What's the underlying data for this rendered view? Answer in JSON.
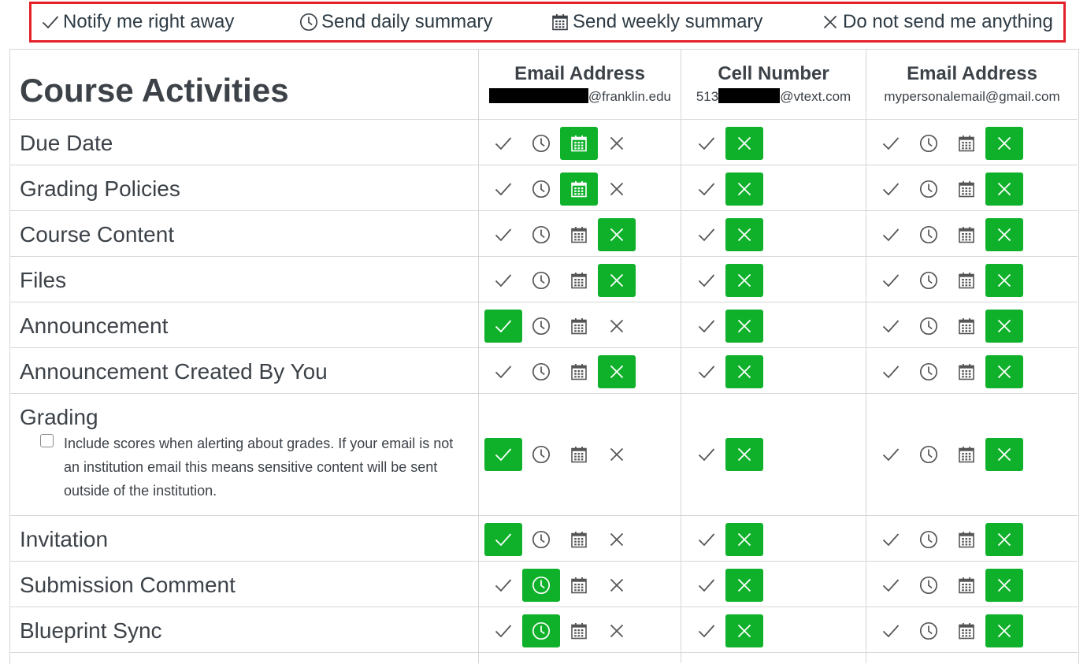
{
  "legend": [
    {
      "icon": "check-icon",
      "label": "Notify me right away"
    },
    {
      "icon": "clock-icon",
      "label": "Send daily summary"
    },
    {
      "icon": "calendar-icon",
      "label": "Send weekly summary"
    },
    {
      "icon": "x-icon",
      "label": "Do not send me anything"
    }
  ],
  "section_title": "Course Activities",
  "channels": [
    {
      "title": "Email Address",
      "address_suffix": "@franklin.edu",
      "options": [
        "check",
        "clock",
        "calendar",
        "x"
      ]
    },
    {
      "title": "Cell Number",
      "address_prefix": "513",
      "address_suffix": "@vtext.com",
      "options": [
        "check",
        "x"
      ]
    },
    {
      "title": "Email Address",
      "address": "mypersonalemail@gmail.com",
      "options": [
        "check",
        "clock",
        "calendar",
        "x"
      ]
    }
  ],
  "grading_note": "Include scores when alerting about grades. If your email is not an institution email this means sensitive content will be sent outside of the institution.",
  "rows": [
    {
      "label": "Due Date",
      "selected": [
        "calendar",
        "x",
        "x"
      ]
    },
    {
      "label": "Grading Policies",
      "selected": [
        "calendar",
        "x",
        "x"
      ]
    },
    {
      "label": "Course Content",
      "selected": [
        "x",
        "x",
        "x"
      ]
    },
    {
      "label": "Files",
      "selected": [
        "x",
        "x",
        "x"
      ]
    },
    {
      "label": "Announcement",
      "selected": [
        "check",
        "x",
        "x"
      ]
    },
    {
      "label": "Announcement Created By You",
      "selected": [
        "x",
        "x",
        "x"
      ]
    },
    {
      "label": "Grading",
      "selected": [
        "check",
        "x",
        "x"
      ]
    },
    {
      "label": "Invitation",
      "selected": [
        "check",
        "x",
        "x"
      ]
    },
    {
      "label": "Submission Comment",
      "selected": [
        "clock",
        "x",
        "x"
      ]
    },
    {
      "label": "Blueprint Sync",
      "selected": [
        "clock",
        "x",
        "x"
      ]
    }
  ],
  "colors": {
    "selected": "#0fb12b",
    "legend_border": "#e32129",
    "grid": "#d6d6d6",
    "icon": "#555555"
  }
}
